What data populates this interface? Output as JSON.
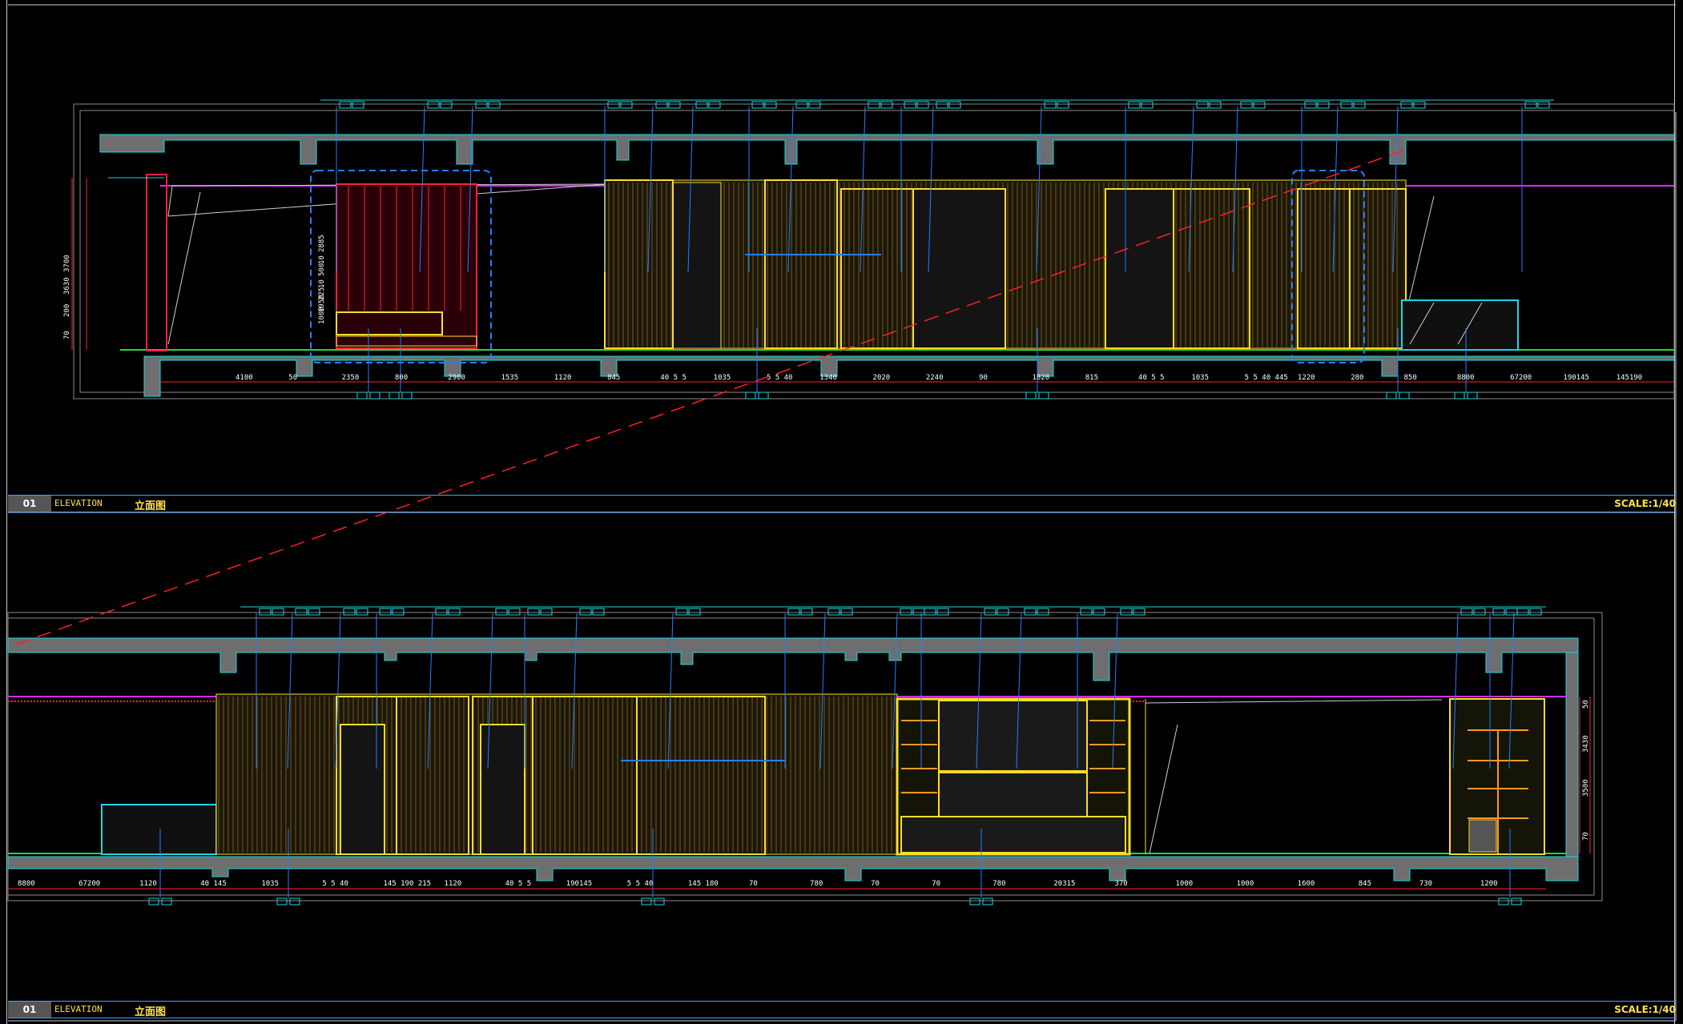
{
  "panels": [
    {
      "number": "01",
      "label_en": "ELEVATION",
      "label_cn": "立面图",
      "scale": "SCALE:1/40",
      "left_dims": [
        "3700",
        "3630",
        "200",
        "70",
        "2885",
        "10",
        "500",
        "10",
        "225",
        "1950",
        "1000"
      ],
      "bottom_dims": [
        "4100",
        "50",
        "2350",
        "800",
        "2900",
        "1535",
        "1120",
        "845",
        "40 5 5",
        "1035",
        "5 5 40",
        "1340",
        "2020",
        "2240",
        "90",
        "1820",
        "815",
        "40 5 5",
        "1035",
        "5 5 40 445",
        "1220",
        "280",
        "850",
        "8800",
        "67200",
        "190145",
        "145190"
      ]
    },
    {
      "number": "01",
      "label_en": "ELEVATION",
      "label_cn": "立面图",
      "scale": "SCALE:1/40",
      "right_dims": [
        "50",
        "3430",
        "3500",
        "70"
      ],
      "bottom_dims": [
        "8800",
        "67200",
        "1120",
        "40 145",
        "1035",
        "5 5 40",
        "145 190 215",
        "1120",
        "40 5 5",
        "190145",
        "5 5 40",
        "145 180",
        "70",
        "780",
        "70",
        "70",
        "780",
        "20315",
        "370",
        "1000",
        "1000",
        "1600",
        "845",
        "730",
        "1200"
      ]
    }
  ],
  "colors": {
    "background": "#000000",
    "concrete": "#6e6e6e",
    "outline": "#19d7e6",
    "dimension": "#ff2020",
    "leader": "#2a7dff",
    "panel_yellow": "#ffdc2a",
    "accent_red": "#ff2040",
    "ceiling_magenta": "#d02cff",
    "floor_green": "#27d640",
    "title_yellow": "#ffe14a"
  }
}
